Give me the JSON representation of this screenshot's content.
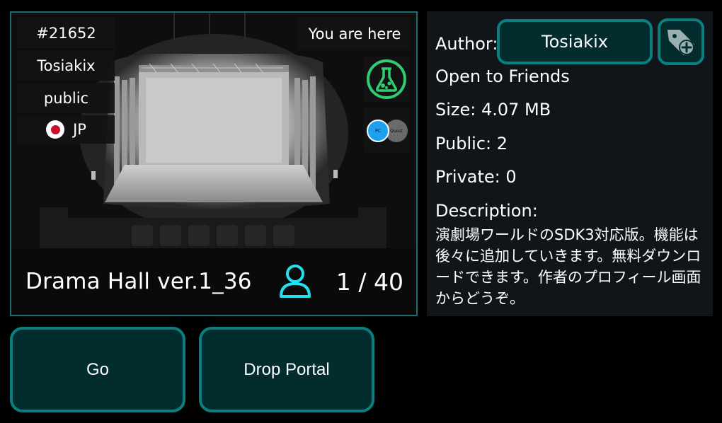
{
  "world": {
    "instance_id": "#21652",
    "owner": "Tosiakix",
    "access": "public",
    "region": "JP",
    "location_status": "You are here",
    "name": "Drama Hall ver.1_36",
    "occupancy": "1 / 40",
    "platforms": [
      "PC",
      "Quest"
    ]
  },
  "actions": {
    "go_label": "Go",
    "drop_portal_label": "Drop Portal"
  },
  "details": {
    "author_label": "Author:",
    "author_name": "Tosiakix",
    "visibility": "Open to Friends",
    "size": "Size: 4.07 MB",
    "public_count": "Public: 2",
    "private_count": "Private: 0",
    "description_label": "Description:",
    "description": "演劇場ワールドのSDK3対応版。機能は後々に追加していきます。無料ダウンロードできます。作者のプロフィール画面からどうぞ。"
  },
  "icons": {
    "person": "person-icon",
    "lab": "flask-icon",
    "tag": "tag-add-icon",
    "flag": "japan-flag-icon"
  },
  "colors": {
    "accent": "#0d7e80",
    "button_bg": "#032c2e",
    "lab_green": "#2fcc71",
    "person_cyan": "#22e0ee",
    "pc_blue": "#1ba1ef"
  }
}
